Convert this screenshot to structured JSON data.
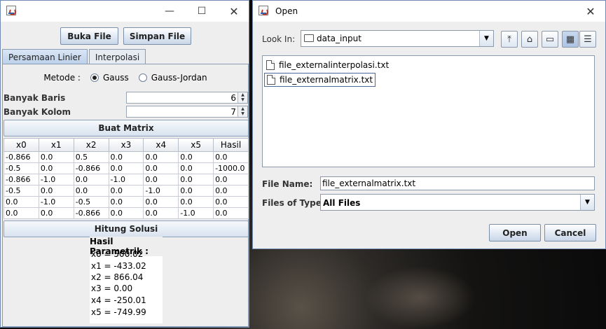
{
  "main_window": {
    "buttons": {
      "open": "Buka File",
      "save": "Simpan File"
    },
    "tabs": [
      {
        "label": "Persamaan Linier"
      },
      {
        "label": "Interpolasi"
      }
    ],
    "method": {
      "label": "Metode :",
      "options": [
        "Gauss",
        "Gauss-Jordan"
      ],
      "selected": "Gauss"
    },
    "rows": {
      "label": "Banyak Baris",
      "value": "6"
    },
    "cols": {
      "label": "Banyak Kolom",
      "value": "7"
    },
    "build_button": "Buat Matrix",
    "table": {
      "headers": [
        "x0",
        "x1",
        "x2",
        "x3",
        "x4",
        "x5",
        "Hasil"
      ],
      "rows": [
        [
          "-0.866",
          "0.0",
          "0.5",
          "0.0",
          "0.0",
          "0.0",
          "0.0"
        ],
        [
          "-0.5",
          "0.0",
          "-0.866",
          "0.0",
          "0.0",
          "0.0",
          "-1000.0"
        ],
        [
          "-0.866",
          "-1.0",
          "0.0",
          "-1.0",
          "0.0",
          "0.0",
          "0.0"
        ],
        [
          "-0.5",
          "0.0",
          "0.0",
          "0.0",
          "-1.0",
          "0.0",
          "0.0"
        ],
        [
          "0.0",
          "-1.0",
          "-0.5",
          "0.0",
          "0.0",
          "0.0",
          "0.0"
        ],
        [
          "0.0",
          "0.0",
          "-0.866",
          "0.0",
          "0.0",
          "-1.0",
          "0.0"
        ]
      ]
    },
    "solve_button": "Hitung Solusi",
    "result": {
      "title": "Hasil Parametrik :",
      "lines": [
        "x0 = 500.02",
        "x1 = -433.02",
        "x2 = 866.04",
        "x3 = 0.00",
        "x4 = -250.01",
        "x5 = -749.99"
      ]
    }
  },
  "open_dialog": {
    "title": "Open",
    "look_in": {
      "label": "Look In:",
      "value": "data_input"
    },
    "toolbar_icons": [
      "up-folder-icon",
      "home-icon",
      "new-folder-icon",
      "list-view-icon",
      "details-view-icon"
    ],
    "files": [
      {
        "name": "file_externalinterpolasi.txt",
        "selected": false
      },
      {
        "name": "file_externalmatrix.txt",
        "selected": true
      }
    ],
    "file_name": {
      "label": "File Name:",
      "value": "file_externalmatrix.txt"
    },
    "file_type": {
      "label": "Files of Type:",
      "value": "All Files"
    },
    "open_button": "Open",
    "cancel_button": "Cancel"
  }
}
